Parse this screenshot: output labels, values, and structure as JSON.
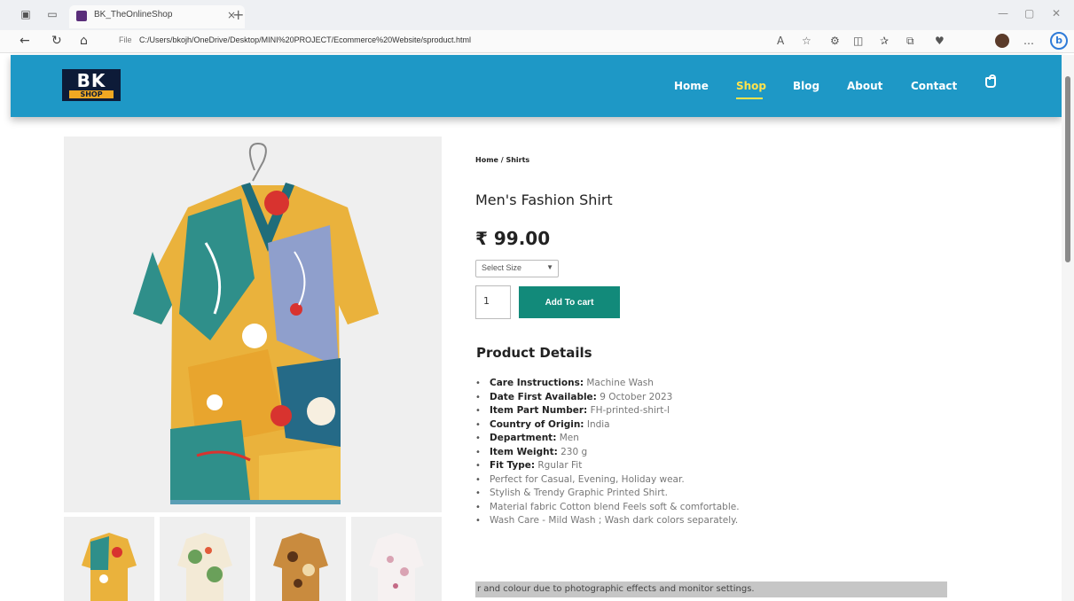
{
  "browser": {
    "tab_title": "BK_TheOnlineShop",
    "url_label": "File",
    "url": "C:/Users/bkojh/OneDrive/Desktop/MINI%20PROJECT/Ecommerce%20Website/sproduct.html"
  },
  "header": {
    "logo_top": "BK",
    "logo_bottom": "SHOP",
    "nav": [
      "Home",
      "Shop",
      "Blog",
      "About",
      "Contact"
    ]
  },
  "product": {
    "breadcrumb": "Home / Shirts",
    "title": "Men's Fashion Shirt",
    "price": "₹ 99.00",
    "size_select": "Select Size",
    "quantity": "1",
    "add_to_cart": "Add To cart",
    "details_heading": "Product Details",
    "details": [
      {
        "label": "Care Instructions:",
        "value": "Machine Wash"
      },
      {
        "label": "Date First Available:",
        "value": "9 October 2023"
      },
      {
        "label": "Item Part Number:",
        "value": "FH-printed-shirt-l"
      },
      {
        "label": "Country of Origin:",
        "value": "India"
      },
      {
        "label": "Department:",
        "value": "Men"
      },
      {
        "label": "Item Weight:",
        "value": "230 g"
      },
      {
        "label": "Fit Type:",
        "value": "Rgular Fit"
      },
      {
        "label": "",
        "value": "Perfect for Casual, Evening, Holiday wear."
      },
      {
        "label": "",
        "value": "Stylish & Trendy Graphic Printed Shirt."
      },
      {
        "label": "",
        "value": "Material fabric Cotton blend Feels soft & comfortable."
      },
      {
        "label": "",
        "value": "Wash Care - Mild Wash ; Wash dark colors separately."
      }
    ],
    "disclaimer": "r and colour due to photographic effects and monitor settings."
  }
}
